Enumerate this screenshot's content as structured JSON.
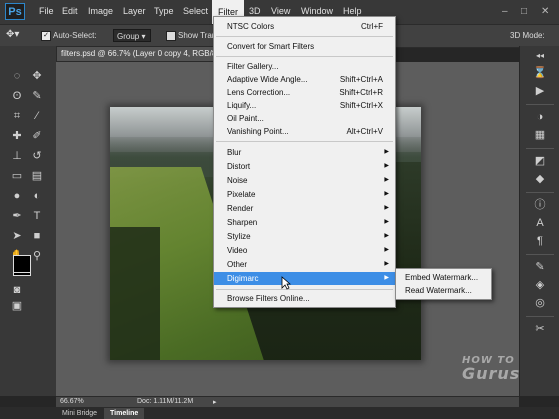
{
  "app": {
    "logo": "Ps"
  },
  "menubar": {
    "items": [
      "File",
      "Edit",
      "Image",
      "Layer",
      "Type",
      "Select",
      "Filter",
      "3D",
      "View",
      "Window",
      "Help"
    ],
    "active": "Filter",
    "window_controls": [
      "–",
      "□",
      "✕"
    ]
  },
  "options": {
    "auto_select_label": "Auto-Select:",
    "auto_select_checked": true,
    "group_value": "Group",
    "show_transform_label": "Show Tran",
    "right_label": "3D Mode:"
  },
  "document": {
    "tab_title": "filters.psd @ 66.7% (Layer 0 copy 4, RGB/8)"
  },
  "status": {
    "zoom": "66.67%",
    "doc_info": "Doc: 1.11M/11.2M"
  },
  "bottom_tabs": [
    {
      "label": "Mini Bridge",
      "active": false
    },
    {
      "label": "Timeline",
      "active": true
    }
  ],
  "watermark": {
    "line1": "HOW TO",
    "line2": "Gurus"
  },
  "filter_menu": {
    "items": [
      {
        "label": "NTSC Colors",
        "shortcut": "Ctrl+F"
      },
      {
        "label": "Convert for Smart Filters",
        "shortcut": ""
      },
      {
        "label": "Filter Gallery...",
        "shortcut": ""
      },
      {
        "label": "Adaptive Wide Angle...",
        "shortcut": "Shift+Ctrl+A"
      },
      {
        "label": "Lens Correction...",
        "shortcut": "Shift+Ctrl+R"
      },
      {
        "label": "Liquify...",
        "shortcut": "Shift+Ctrl+X"
      },
      {
        "label": "Oil Paint...",
        "shortcut": ""
      },
      {
        "label": "Vanishing Point...",
        "shortcut": "Alt+Ctrl+V"
      },
      {
        "label": "Blur",
        "shortcut": ""
      },
      {
        "label": "Distort",
        "shortcut": ""
      },
      {
        "label": "Noise",
        "shortcut": ""
      },
      {
        "label": "Pixelate",
        "shortcut": ""
      },
      {
        "label": "Render",
        "shortcut": ""
      },
      {
        "label": "Sharpen",
        "shortcut": ""
      },
      {
        "label": "Stylize",
        "shortcut": ""
      },
      {
        "label": "Video",
        "shortcut": ""
      },
      {
        "label": "Other",
        "shortcut": ""
      },
      {
        "label": "Digimarc",
        "shortcut": "",
        "highlighted": true
      },
      {
        "label": "Browse Filters Online...",
        "shortcut": ""
      }
    ]
  },
  "digimarc_submenu": {
    "items": [
      "Embed Watermark...",
      "Read Watermark..."
    ]
  },
  "icons": {
    "left_tools": [
      "move-icon",
      "marquee-icon",
      "lasso-icon",
      "quick-select-icon",
      "crop-icon",
      "eyedropper-icon",
      "healing-icon",
      "brush-icon",
      "clone-stamp-icon",
      "history-brush-icon",
      "eraser-icon",
      "gradient-icon",
      "blur-tool-icon",
      "dodge-icon",
      "pen-icon",
      "type-icon",
      "path-select-icon",
      "shape-icon",
      "hand-icon",
      "zoom-icon"
    ],
    "right_panels": [
      "history-icon",
      "actions-icon",
      "color-icon",
      "swatches-icon",
      "adjustments-icon",
      "styles-icon",
      "info-icon",
      "character-icon",
      "paragraph-icon",
      "brush-panel-icon",
      "layers-icon",
      "channels-icon",
      "paths-icon",
      "properties-icon"
    ]
  }
}
